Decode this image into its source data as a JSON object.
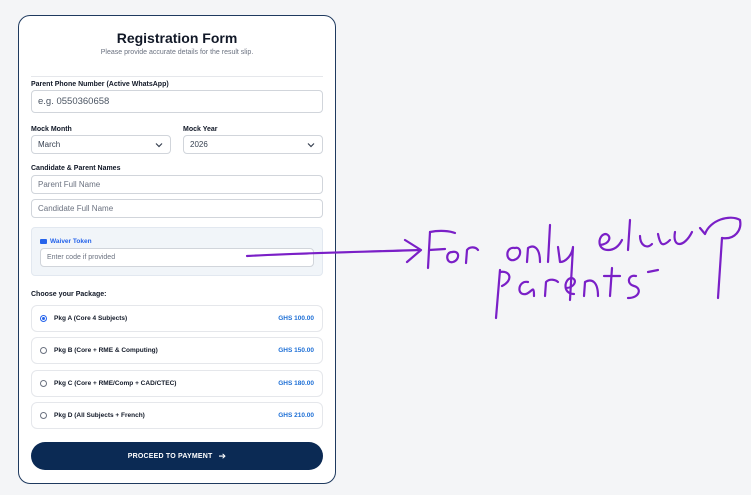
{
  "form": {
    "title": "Registration Form",
    "subtitle": "Please provide accurate details for the result slip."
  },
  "phone": {
    "label": "Parent Phone Number (Active WhatsApp)",
    "placeholder": "e.g. 0550360658"
  },
  "mock_month": {
    "label": "Mock Month",
    "value": "March"
  },
  "mock_year": {
    "label": "Mock Year",
    "value": "2026"
  },
  "names": {
    "label": "Candidate & Parent Names",
    "parent_placeholder": "Parent Full Name",
    "candidate_placeholder": "Candidate Full Name"
  },
  "waiver": {
    "label": "Waiver Token",
    "placeholder": "Enter code if provided",
    "icon": "card-icon"
  },
  "packages": {
    "label": "Choose your Package:",
    "items": [
      {
        "name": "Pkg A (Core 4 Subjects)",
        "price": "GHS 100.00",
        "selected": true
      },
      {
        "name": "Pkg B (Core + RME & Computing)",
        "price": "GHS 150.00",
        "selected": false
      },
      {
        "name": "Pkg C (Core + RME/Comp + CAD/CTEC)",
        "price": "GHS 180.00",
        "selected": false
      },
      {
        "name": "Pkg D (All Subjects + French)",
        "price": "GHS 210.00",
        "selected": false
      }
    ]
  },
  "submit": {
    "label": "PROCEED TO PAYMENT",
    "arrow": "➔"
  },
  "annotation": {
    "handwritten_text": "For only eligible parents"
  },
  "colors": {
    "accent": "#2563eb",
    "button": "#0b2a54",
    "price": "#1d6fd6",
    "annotation": "#7a1fc7"
  }
}
